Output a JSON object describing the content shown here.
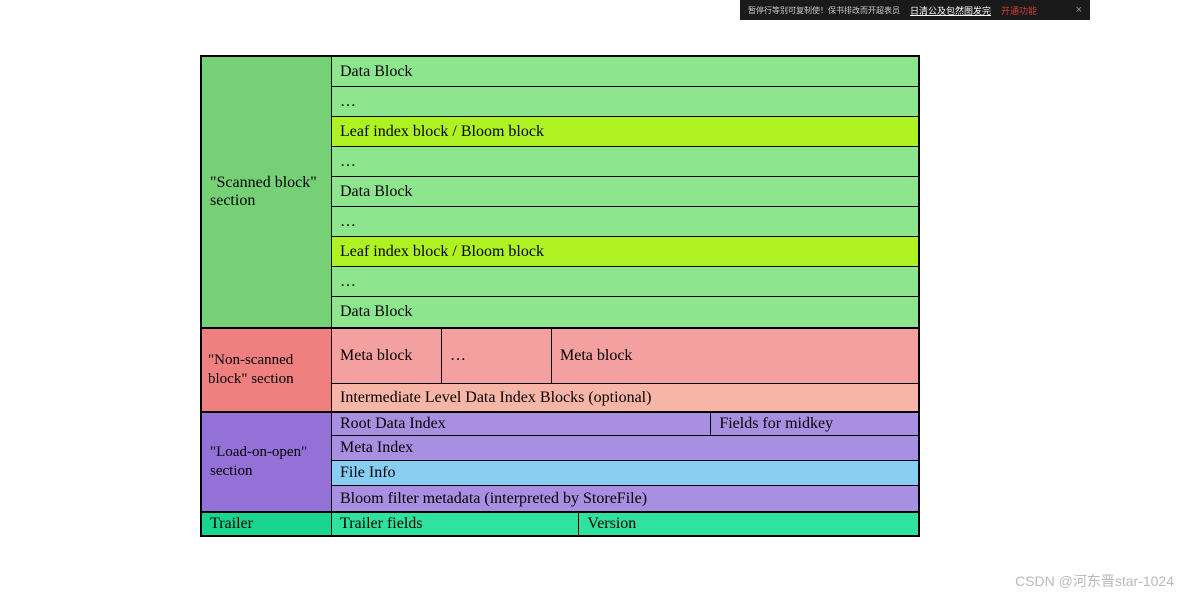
{
  "topBar": {
    "text1": "暂停行等别可复制使！保书排改而开超表员",
    "link": "日清公及包然图发完",
    "red": "开通功能",
    "close": "×"
  },
  "sections": {
    "scanned": {
      "label": "\"Scanned block\" section",
      "rows": [
        {
          "text": "Data Block",
          "style": "green-light"
        },
        {
          "text": "…",
          "style": "green-light"
        },
        {
          "text": "Leaf index block / Bloom block",
          "style": "green-lime"
        },
        {
          "text": "…",
          "style": "green-light"
        },
        {
          "text": "Data Block",
          "style": "green-light"
        },
        {
          "text": "…",
          "style": "green-light"
        },
        {
          "text": "Leaf index block / Bloom block",
          "style": "green-lime"
        },
        {
          "text": "…",
          "style": "green-light"
        },
        {
          "text": "Data Block",
          "style": "green-light"
        }
      ]
    },
    "nonscanned": {
      "label": "\"Non-scanned block\" section",
      "meta1": "Meta block",
      "meta2": "…",
      "meta3": "Meta block",
      "intermediate": "Intermediate Level Data Index Blocks (optional)"
    },
    "loadopen": {
      "label": "\"Load-on-open\" section",
      "root": "Root Data Index",
      "midkey": "Fields for midkey",
      "metaidx": "Meta Index",
      "fileinfo": "File Info",
      "bloom": "Bloom filter metadata (interpreted by StoreFile)"
    },
    "trailer": {
      "label": "Trailer",
      "fields": "Trailer fields",
      "version": "Version"
    }
  },
  "watermark": "CSDN @河东晋star-1024"
}
